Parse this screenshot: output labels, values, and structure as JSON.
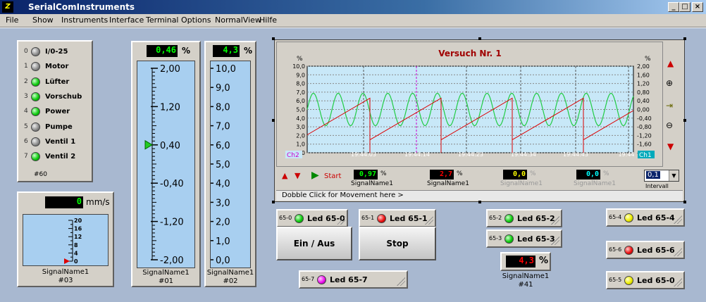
{
  "app": {
    "title": "SerialComInstruments",
    "icon_glyph": "Z"
  },
  "window_buttons": {
    "minimize": "_",
    "maximize": "□",
    "close": "×"
  },
  "menu": [
    "File",
    "Show",
    "Instruments",
    "Interface",
    "Terminal",
    "Options",
    "NormalView",
    "Hilfe"
  ],
  "led_panel": {
    "items": [
      {
        "index": "0",
        "label": "I/0-25",
        "state": "gray"
      },
      {
        "index": "1",
        "label": "Motor",
        "state": "gray"
      },
      {
        "index": "2",
        "label": "Lüfter",
        "state": "green"
      },
      {
        "index": "3",
        "label": "Vorschub",
        "state": "green"
      },
      {
        "index": "4",
        "label": "Power",
        "state": "green"
      },
      {
        "index": "5",
        "label": "Pumpe",
        "state": "gray"
      },
      {
        "index": "6",
        "label": "Ventil 1",
        "state": "gray"
      },
      {
        "index": "7",
        "label": "Ventil 2",
        "state": "green"
      }
    ],
    "id": "#60"
  },
  "speed": {
    "value": "0",
    "unit": "mm/s",
    "scale": [
      "20",
      "16",
      "12",
      "8",
      "4",
      "0"
    ],
    "name": "SignalName1",
    "id": "#03",
    "level": 0
  },
  "gauge1": {
    "value": "0,46",
    "unit": "%",
    "scale": [
      "2,00",
      "1,20",
      "0,40",
      "-0,40",
      "-1,20",
      "-2,00"
    ],
    "name": "SignalName1",
    "id": "#01",
    "pointer": 0.4,
    "min": -2.0,
    "max": 2.0
  },
  "gauge2": {
    "value": "4,3",
    "unit": "%",
    "scale": [
      "10,0",
      "9,0",
      "8,0",
      "7,0",
      "6,0",
      "5,0",
      "4,0",
      "3,0",
      "2,0",
      "1,0",
      "0,0"
    ],
    "name": "SignalName1",
    "id": "#02",
    "pointer": 4.3,
    "min": 0,
    "max": 10
  },
  "chart": {
    "title": "Versuch Nr. 1",
    "unit_left": "%",
    "unit_right": "%",
    "left_ticks": [
      "10,0",
      "9,0",
      "8,0",
      "7,0",
      "6,0",
      "5,0",
      "4,0",
      "3,0",
      "2,0",
      "1,0",
      "0,0"
    ],
    "right_ticks": [
      "2,00",
      "1,60",
      "1,20",
      "0,80",
      "0,40",
      "0,00",
      "-0,40",
      "-0,80",
      "-1,20",
      "-1,60",
      "-2,00"
    ],
    "time_labels": [
      "19:44:03",
      "19:44:14",
      "19:44:23",
      "19:44:34",
      "19:44:43",
      "19:44"
    ],
    "ch_left": "Ch2",
    "ch_right": "Ch1",
    "start_label": "Start",
    "readouts": [
      {
        "value": "0,97",
        "unit": "%",
        "name": "SignalName1",
        "active": true,
        "color": "#0f0"
      },
      {
        "value": "2,7",
        "unit": "%",
        "name": "SignalName1",
        "active": true,
        "color": "#f00"
      },
      {
        "value": "0,0",
        "unit": "%",
        "name": "SignalName1",
        "active": false,
        "color": "#ff0"
      },
      {
        "value": "0,0",
        "unit": "%",
        "name": "SignalName1",
        "active": false,
        "color": "#0ff"
      }
    ],
    "interval_value": "0,1",
    "interval_label": "Intervall",
    "footer": "Dobble Click for Movement here >"
  },
  "chart_data": {
    "type": "line",
    "title": "Versuch Nr. 1",
    "x": [
      "19:44:03",
      "19:44:14",
      "19:44:23",
      "19:44:34",
      "19:44:43"
    ],
    "series": [
      {
        "name": "Ch1",
        "color": "#22cc44",
        "kind": "sine",
        "amplitude": 0.75,
        "offset": 0
      },
      {
        "name": "Ch2",
        "color": "#dd0000",
        "kind": "sawtooth",
        "min": 1.5,
        "max": 6.3
      }
    ],
    "ylim_left": [
      0,
      10
    ],
    "ylim_right": [
      -2,
      2
    ]
  },
  "leds": [
    {
      "id": "65-0",
      "label": "Led 65-0",
      "color": "green"
    },
    {
      "id": "65-1",
      "label": "Led 65-1",
      "color": "red"
    },
    {
      "id": "65-2",
      "label": "Led 65-2",
      "color": "green"
    },
    {
      "id": "65-3",
      "label": "Led 65-3",
      "color": "green"
    },
    {
      "id": "65-4",
      "label": "Led 65-4",
      "color": "yellow"
    },
    {
      "id": "65-6",
      "label": "Led 65-6",
      "color": "red"
    },
    {
      "id": "65-5",
      "label": "Led 65-0",
      "color": "yellow"
    },
    {
      "id": "65-7",
      "label": "Led 65-7",
      "color": "magenta"
    }
  ],
  "buttons": {
    "onoff": "Ein / Aus",
    "stop": "Stop"
  },
  "display41": {
    "value": "4,3",
    "unit": "%",
    "name": "SignalName1",
    "id": "#41"
  }
}
